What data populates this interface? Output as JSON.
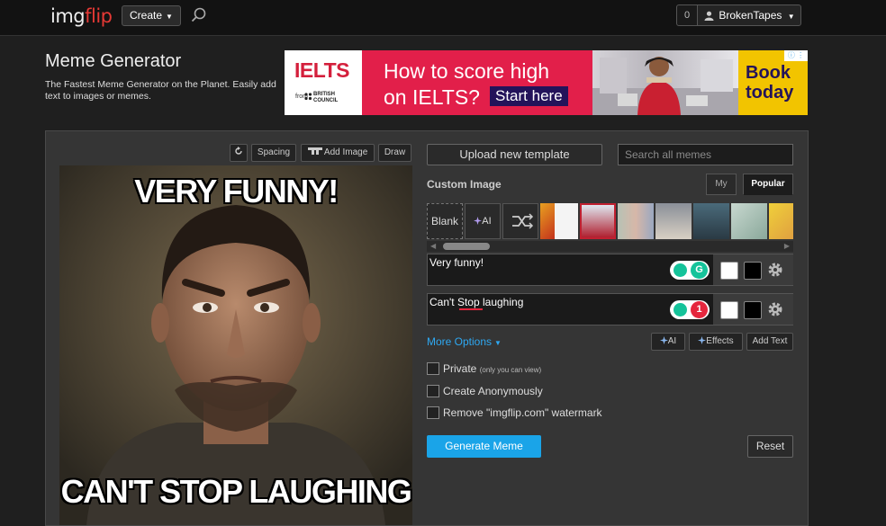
{
  "header": {
    "logo_part1": "img",
    "logo_part2": "flip",
    "create_label": "Create",
    "notification_count": "0",
    "username": "BrokenTapes"
  },
  "page": {
    "title": "Meme Generator",
    "subtitle": "The Fastest Meme Generator on the Planet. Easily add text to images or memes."
  },
  "ad": {
    "brand": "IELTS",
    "from_label": "from",
    "partner": "BRITISH COUNCIL",
    "headline_line1": "How to score high",
    "headline_line2": "on IELTS?",
    "cta": "Start here",
    "side_line1": "Book",
    "side_line2": "today",
    "badge": "ⓘ ⋮"
  },
  "editor_toolbar": {
    "rotate_icon": "rotate-icon",
    "spacing_label": "Spacing",
    "add_image_label": "Add Image",
    "draw_label": "Draw"
  },
  "meme": {
    "top_text": "VERY FUNNY!",
    "bottom_text": "CAN'T STOP LAUGHING"
  },
  "templates": {
    "upload_label": "Upload new template",
    "search_placeholder": "Search all memes",
    "custom_label": "Custom Image",
    "tab_my": "My",
    "tab_popular": "Popular",
    "blank_label": "Blank",
    "ai_label": "AI",
    "shuffle_icon": "shuffle-icon"
  },
  "text_boxes": [
    {
      "value": "Very funny!",
      "badge_count": "",
      "badge_color": "#15c39a"
    },
    {
      "value": "Can't Stop laughing",
      "badge_count": "1",
      "badge_color": "#e5263d"
    }
  ],
  "options": {
    "more_options": "More Options",
    "ai_button": "AI",
    "effects_button": "Effects",
    "add_text_button": "Add Text",
    "private_label": "Private",
    "private_note": "(only you can view)",
    "anon_label": "Create Anonymously",
    "watermark_label": "Remove \"imgflip.com\" watermark"
  },
  "actions": {
    "generate": "Generate Meme",
    "reset": "Reset"
  },
  "colors": {
    "accent_blue": "#1aa4e8",
    "link_blue": "#2ea8f2",
    "logo_red": "#e53935",
    "ad_red": "#e21f4a",
    "ad_yellow": "#f2c400"
  }
}
